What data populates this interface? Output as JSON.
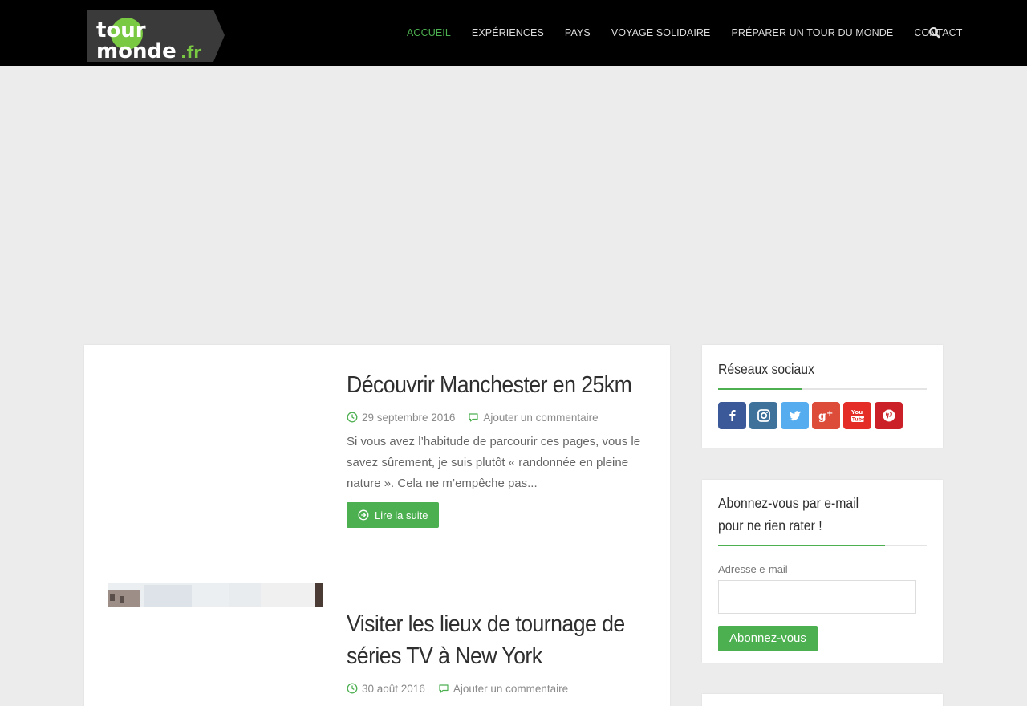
{
  "header": {
    "logo_text_1": "tour",
    "logo_text_2": "monde",
    "logo_text_3": ".fr",
    "nav": [
      {
        "label": "ACCUEIL",
        "active": true
      },
      {
        "label": "EXPÉRIENCES",
        "active": false
      },
      {
        "label": "PAYS",
        "active": false
      },
      {
        "label": "VOYAGE SOLIDAIRE",
        "active": false
      },
      {
        "label": "PRÉPARER UN TOUR DU MONDE",
        "active": false
      },
      {
        "label": "CONTACT",
        "active": false
      }
    ],
    "search_icon": "search-icon"
  },
  "posts": [
    {
      "title": "Découvrir Manchester en 25km",
      "date": "29 septembre 2016",
      "comments": "Ajouter un commentaire",
      "excerpt": "Si vous avez l’habitude de parcourir ces pages, vous le savez sûrement, je suis plutôt « randonnée en pleine nature ». Cela ne m’empêche pas...",
      "read_more": "Lire la suite"
    },
    {
      "title": "Visiter les lieux de tournage de séries TV à New York",
      "date": "30 août 2016",
      "comments": "Ajouter un commentaire"
    }
  ],
  "sidebar": {
    "social": {
      "title": "Réseaux sociaux",
      "icons": [
        "facebook-icon",
        "instagram-icon",
        "twitter-icon",
        "google-plus-icon",
        "youtube-icon",
        "pinterest-icon"
      ]
    },
    "subscribe": {
      "title_line1": "Abonnez-vous par e-mail",
      "title_line2": "pour ne rien rater !",
      "email_label": "Adresse e-mail",
      "email_value": "",
      "button_label": "Abonnez-vous"
    }
  },
  "colors": {
    "accent": "#4caf50",
    "navbar": "#000000",
    "facebook": "#3b5998",
    "instagram": "#3f729b",
    "twitter": "#55acee",
    "google_plus": "#dd4b39",
    "youtube": "#e52d27",
    "pinterest": "#cb2027"
  }
}
